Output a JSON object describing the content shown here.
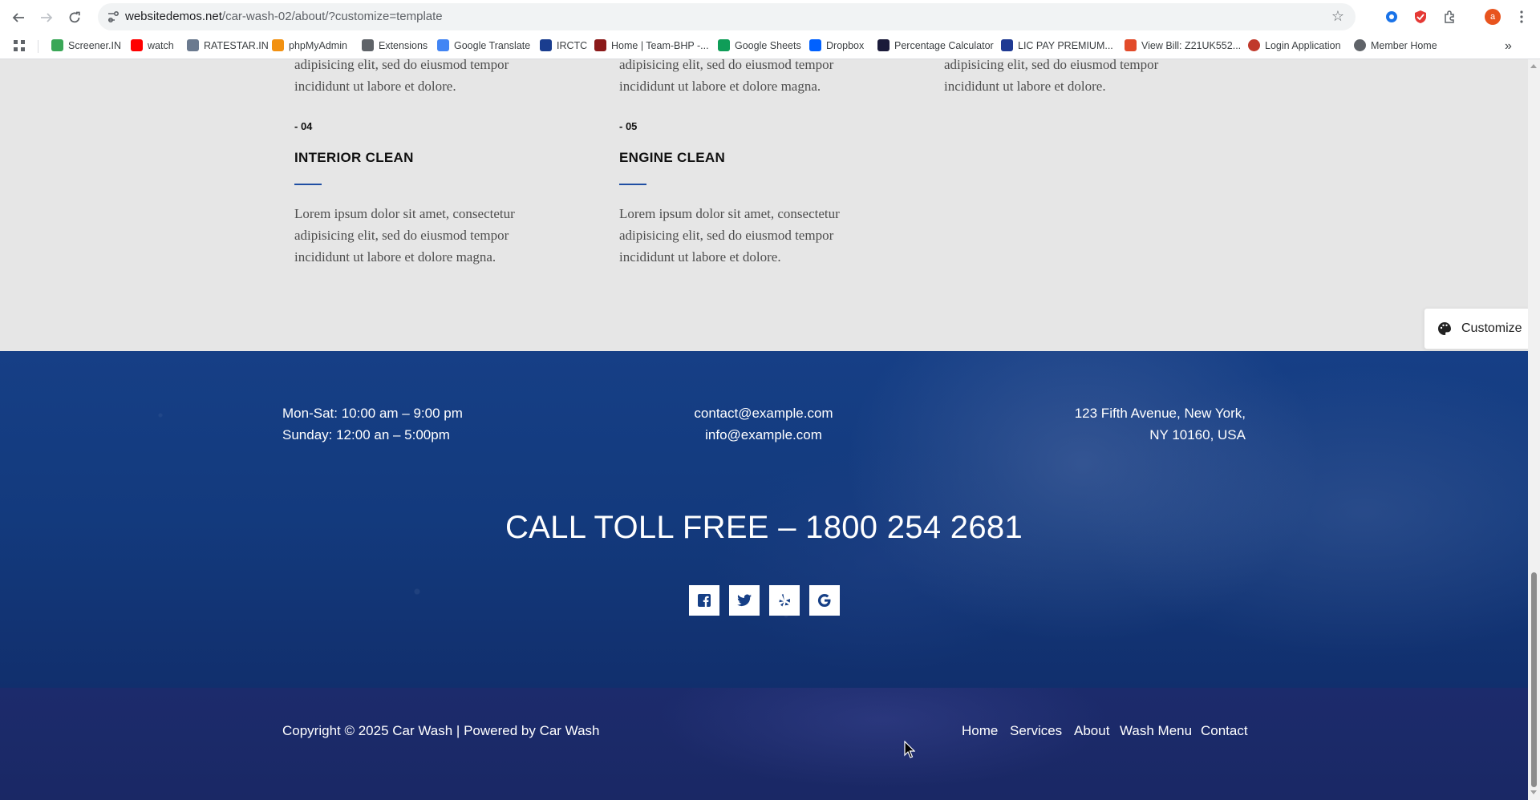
{
  "browser": {
    "url_domain": "websitedemos.net",
    "url_path": "/car-wash-02/about/?customize=template",
    "profile_initial": "a",
    "bookmarks": [
      {
        "label": "Screener.IN",
        "color": "#3aa757"
      },
      {
        "label": "watch",
        "color": "#ff0000"
      },
      {
        "label": "RATESTAR.IN",
        "color": "#6b7a8f"
      },
      {
        "label": "phpMyAdmin",
        "color": "#f29111"
      },
      {
        "label": "Extensions",
        "color": "#5f6368"
      },
      {
        "label": "Google Translate",
        "color": "#4285f4"
      },
      {
        "label": "IRCTC",
        "color": "#1a3d8f"
      },
      {
        "label": "Home | Team-BHP -...",
        "color": "#8b1a1a"
      },
      {
        "label": "Google Sheets",
        "color": "#0f9d58"
      },
      {
        "label": "Dropbox",
        "color": "#0061ff"
      },
      {
        "label": "Percentage Calculator",
        "color": "#1b1b3a"
      },
      {
        "label": "LIC PAY PREMIUM...",
        "color": "#1f3a93"
      },
      {
        "label": "View Bill: Z21UK552...",
        "color": "#e24b2a"
      },
      {
        "label": "Login Application",
        "color": "#c0392b"
      },
      {
        "label": "Member Home",
        "color": "#5f6368"
      }
    ]
  },
  "services": {
    "top_row": [
      {
        "line1": "adipisicing elit, sed do eiusmod tempor",
        "line2": "incididunt ut labore et dolore."
      },
      {
        "line1": "adipisicing elit, sed do eiusmod tempor",
        "line2": "incididunt ut labore et dolore magna."
      },
      {
        "line1": "adipisicing elit, sed do eiusmod tempor",
        "line2": "incididunt ut labore et dolore."
      }
    ],
    "items": [
      {
        "number": "- 04",
        "title": "INTERIOR CLEAN",
        "line1": "Lorem ipsum dolor sit amet, consectetur",
        "line2": "adipisicing elit, sed do eiusmod tempor",
        "line3": "incididunt ut labore et dolore magna."
      },
      {
        "number": "- 05",
        "title": "ENGINE CLEAN",
        "line1": "Lorem ipsum dolor sit amet, consectetur",
        "line2": "adipisicing elit, sed do eiusmod tempor",
        "line3": "incididunt ut labore et dolore."
      }
    ]
  },
  "customize_label": "Customize",
  "footer": {
    "hours_weekday": "Mon-Sat: 10:00 am – 9:00 pm",
    "hours_sunday": "Sunday: 12:00 an – 5:00pm",
    "email_contact": "contact@example.com",
    "email_info": "info@example.com",
    "address_line1": "123 Fifth Avenue, New York,",
    "address_line2": "NY 10160, USA",
    "toll_free": "CALL TOLL FREE – 1800 254 2681",
    "social": [
      "facebook-icon",
      "twitter-icon",
      "yelp-icon",
      "google-icon"
    ],
    "copyright": "Copyright © 2025 Car Wash | Powered by Car Wash",
    "nav": [
      "Home",
      "Services",
      "About",
      "Wash Menu",
      "Contact"
    ]
  },
  "colors": {
    "accent_line": "#1f4ea3",
    "footer_blue": "#163f86",
    "bottom_bar": "#1c2b6c"
  }
}
